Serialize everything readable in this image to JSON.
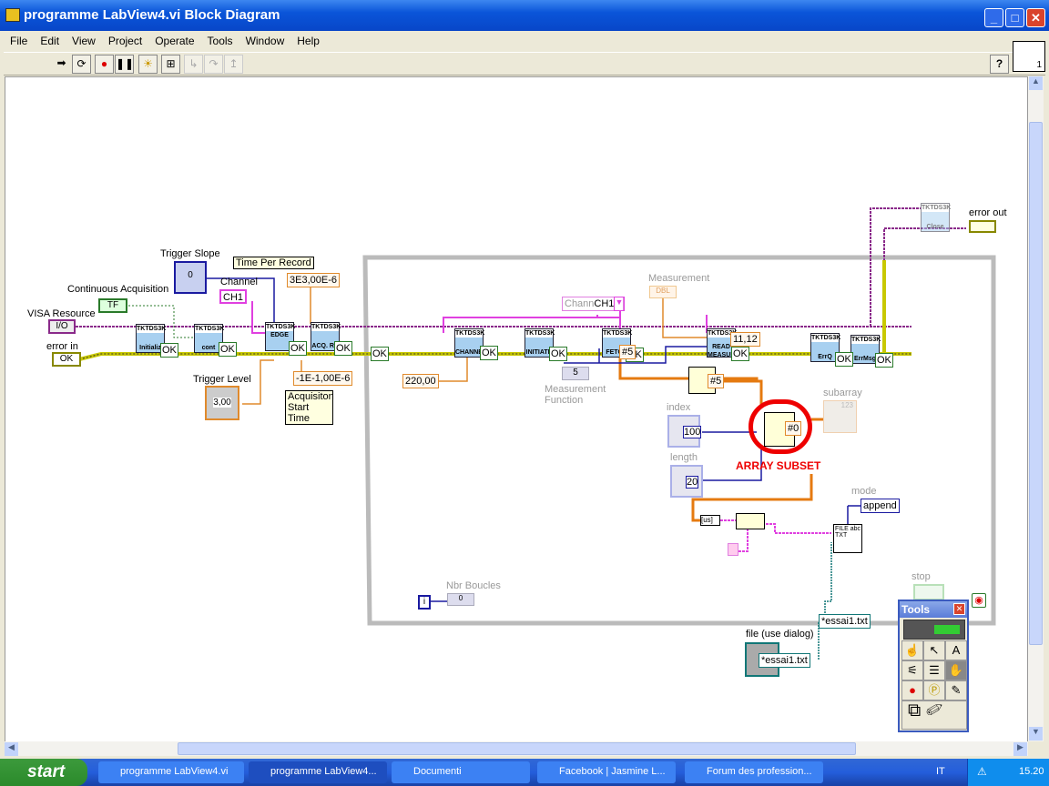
{
  "window": {
    "title": "programme LabView4.vi Block Diagram",
    "minimize": "_",
    "maximize": "□",
    "close": "✕"
  },
  "menu": [
    "File",
    "Edit",
    "View",
    "Project",
    "Operate",
    "Tools",
    "Window",
    "Help"
  ],
  "toolbar": {
    "help": "?",
    "vi_icon_number": "1"
  },
  "diagram": {
    "trigger_slope": {
      "label": "Trigger Slope",
      "value": "0",
      "type": "I32"
    },
    "time_per_record": {
      "label": "Time Per Record",
      "value": "3E3,00E-6"
    },
    "channel": {
      "label": "Channel",
      "value": "CH1"
    },
    "continuous_acquisition": {
      "label": "Continuous Acquisition",
      "value": "TF"
    },
    "visa_resource": {
      "label": "VISA Resource",
      "value": "I/O"
    },
    "error_in": {
      "label": "error in",
      "value": "OK"
    },
    "trigger_level": {
      "label": "Trigger Level",
      "value": "3,00",
      "type": "DBL"
    },
    "acq_start_time": {
      "label": "Acquisiton Start Time",
      "value": "-1E-1,00E-6"
    },
    "vis": [
      {
        "vendor": "TKTDS3K",
        "name": "Initializ"
      },
      {
        "vendor": "TKTDS3K",
        "name": "cont"
      },
      {
        "vendor": "TKTDS3K",
        "name": "EDGE"
      },
      {
        "vendor": "TKTDS3K",
        "name": "ACQ. RE"
      },
      {
        "vendor": "TKTDS3K",
        "name": "CHANNEL"
      },
      {
        "vendor": "TKTDS3K",
        "name": "INITIATE"
      },
      {
        "vendor": "TKTDS3K",
        "name": "FETCH"
      },
      {
        "vendor": "TKTDS3K",
        "name": "READ MEASUR"
      },
      {
        "vendor": "TKTDS3K",
        "name": "ErrQ"
      },
      {
        "vendor": "TKTDS3K",
        "name": "ErrMsg"
      },
      {
        "vendor": "TKTDS3K",
        "name": "Close"
      }
    ],
    "ok": "OK",
    "vertical_range": "220,00",
    "channel_const": {
      "label": "Chann",
      "value": "CH1"
    },
    "measurement": {
      "label": "Measurement",
      "type": "DBL"
    },
    "measurement_function": {
      "label": "Measurement Function",
      "value": "5"
    },
    "fetch_index": "#5",
    "read_value": "11,12",
    "index_array_out": "#5",
    "index": {
      "label": "index",
      "value": "100",
      "type": "I32"
    },
    "length": {
      "label": "length",
      "value": "20",
      "type": "I32"
    },
    "array_subset": {
      "annotation": "ARRAY SUBSET",
      "out": "#0"
    },
    "subarray": {
      "label": "subarray",
      "value": "123",
      "type": "DBL"
    },
    "error_out": {
      "label": "error out"
    },
    "mode": {
      "label": "mode",
      "value": "append"
    },
    "to_string": "[us]",
    "write_file": "FILE abc TXT",
    "nbr_boucles": {
      "label": "Nbr Boucles",
      "value": "0",
      "type": "I32"
    },
    "stop": {
      "label": "stop"
    },
    "file_path_const": "*essai1.txt",
    "file_dialog": {
      "label": "file (use dialog)",
      "value": "*essai1.txt"
    }
  },
  "tools_palette": {
    "title": "Tools",
    "close": "✕"
  },
  "taskbar": {
    "start": "start",
    "items": [
      "programme LabView4.vi",
      "programme LabView4...",
      "Documenti",
      "Facebook | Jasmine L...",
      "Forum des profession..."
    ],
    "lang": "IT",
    "clock": "15.20"
  }
}
